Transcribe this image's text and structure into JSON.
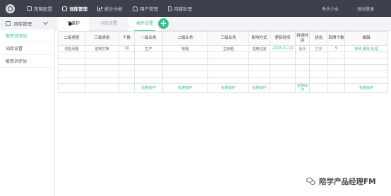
{
  "header": {
    "nav": [
      {
        "label": "策略配置",
        "icon": "monitor-icon"
      },
      {
        "label": "词库管理",
        "icon": "database-icon"
      },
      {
        "label": "统计分析",
        "icon": "chart-icon"
      },
      {
        "label": "用户管理",
        "icon": "user-icon"
      },
      {
        "label": "内容处理",
        "icon": "document-icon"
      }
    ],
    "user": "秃头少女",
    "logout": "退出登录"
  },
  "sidebar": {
    "title": "词库管理",
    "items": [
      {
        "label": "敏感词添加"
      },
      {
        "label": "词库设置"
      },
      {
        "label": "敏感词评估"
      }
    ]
  },
  "tabs": [
    {
      "label": "词维护"
    },
    {
      "label": "词库设置"
    },
    {
      "label": "插件设置"
    }
  ],
  "add_button": "+",
  "table": {
    "headers": [
      "二级类别",
      "三级类别",
      "个数",
      "一级业务",
      "二级业务",
      "三级业务",
      "影响方式",
      "更新时间",
      "持续时间",
      "状态",
      "回溯个数",
      "编辑"
    ],
    "first_row": [
      "词包问题",
      "违规文档",
      "20",
      "生产",
      "标题",
      "立标题",
      "信用过滤",
      "2018-01-18",
      "永久",
      "生效",
      "5",
      "修改 删除 处理"
    ],
    "action_row": [
      "",
      "",
      "",
      "批量操作",
      "批量操作",
      "批量操作",
      "批量操作",
      "",
      "批量操作",
      "",
      "",
      "批量操作"
    ]
  },
  "watermark": "陪学产品经理FM"
}
